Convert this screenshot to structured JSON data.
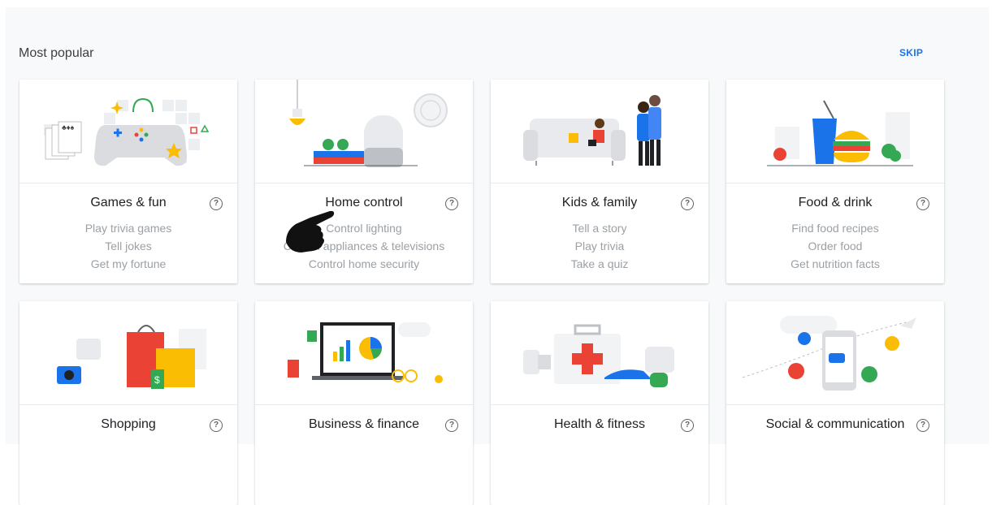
{
  "header": {
    "title": "Most popular",
    "skip_label": "SKIP"
  },
  "help_glyph": "?",
  "cards": [
    {
      "title": "Games & fun",
      "examples": [
        "Play trivia games",
        "Tell jokes",
        "Get my fortune"
      ]
    },
    {
      "title": "Home control",
      "examples": [
        "Control lighting",
        "Control appliances & televisions",
        "Control home security"
      ]
    },
    {
      "title": "Kids & family",
      "examples": [
        "Tell a story",
        "Play trivia",
        "Take a quiz"
      ]
    },
    {
      "title": "Food & drink",
      "examples": [
        "Find food recipes",
        "Order food",
        "Get nutrition facts"
      ]
    },
    {
      "title": "Shopping",
      "examples": []
    },
    {
      "title": "Business & finance",
      "examples": []
    },
    {
      "title": "Health & fitness",
      "examples": []
    },
    {
      "title": "Social & communication",
      "examples": []
    }
  ],
  "colors": {
    "accent": "#1a73e8",
    "background": "#f8f9fa",
    "muted_text": "#9aa0a6"
  }
}
